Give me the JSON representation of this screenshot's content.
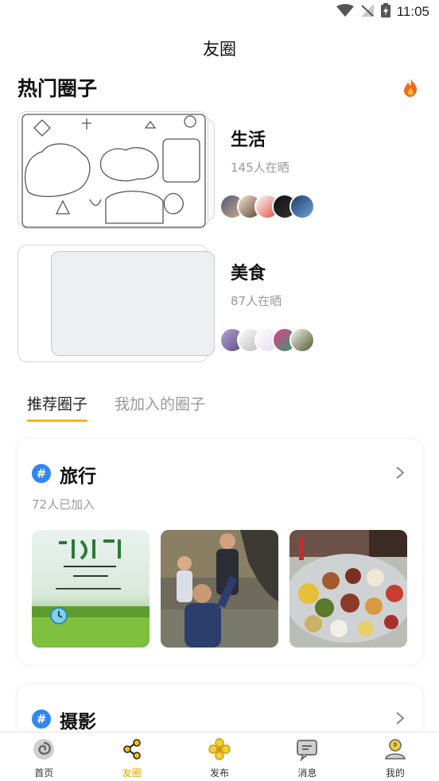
{
  "status_bar": {
    "time": "11:05"
  },
  "header": {
    "title": "友圈"
  },
  "hot_section": {
    "title": "热门圈子",
    "circles": [
      {
        "name": "生活",
        "count": "145人在晒"
      },
      {
        "name": "美食",
        "count": "87人在晒"
      }
    ]
  },
  "tabs": [
    {
      "label": "推荐圈子",
      "active": true
    },
    {
      "label": "我加入的圈子",
      "active": false
    }
  ],
  "recommended": [
    {
      "name": "旅行",
      "count": "72人已加入"
    },
    {
      "name": "摄影",
      "count": ""
    }
  ],
  "bottom_nav": [
    {
      "label": "首页",
      "active": false
    },
    {
      "label": "友圈",
      "active": true
    },
    {
      "label": "发布",
      "active": false
    },
    {
      "label": "消息",
      "active": false
    },
    {
      "label": "我的",
      "active": false
    }
  ],
  "colors": {
    "accent": "#f2b705",
    "tag_blue": "#2f86f6"
  }
}
